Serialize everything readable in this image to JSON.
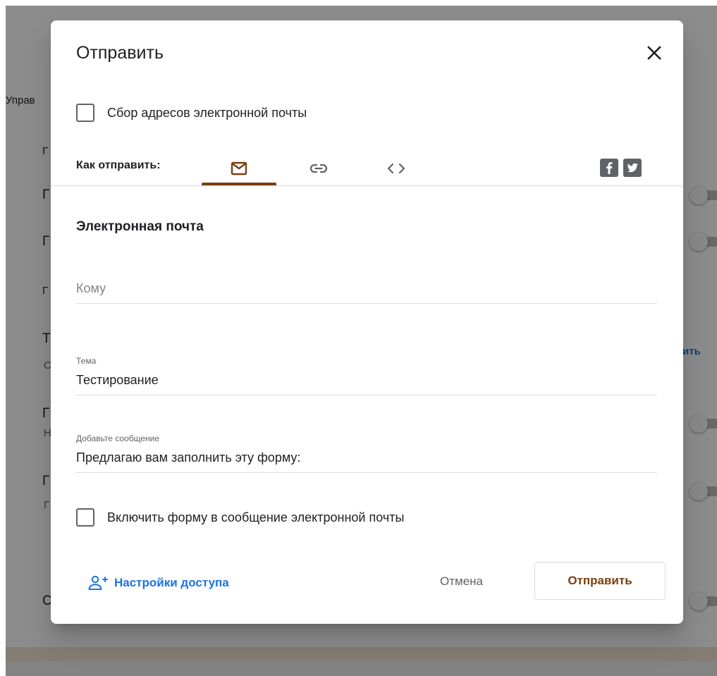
{
  "background": {
    "manage_label": "Управ",
    "row_letters": [
      "Г",
      "Г",
      "Г",
      "Г",
      "Т",
      "Г",
      "Г",
      "С"
    ],
    "row_subs": [
      "С",
      "Н",
      "Г"
    ],
    "link_fragment": "ить"
  },
  "dialog": {
    "title": "Отправить",
    "collect_emails_label": "Сбор адресов электронной почты",
    "send_via_label": "Как отправить:",
    "tabs": {
      "email": "email-icon",
      "link": "link-icon",
      "embed": "embed-code-icon",
      "active": "email"
    },
    "social": {
      "facebook": "facebook-icon",
      "twitter": "twitter-icon"
    },
    "section_title": "Электронная почта",
    "to": {
      "placeholder": "Кому",
      "value": ""
    },
    "subject": {
      "label": "Тема",
      "value": "Тестирование"
    },
    "message": {
      "label": "Добавьте сообщение",
      "value": "Предлагаю вам заполнить эту форму:"
    },
    "include_form_label": "Включить форму в сообщение электронной почты",
    "share_settings_label": "Настройки доступа",
    "cancel_label": "Отмена",
    "send_label": "Отправить"
  },
  "colors": {
    "accent": "#7a3f0c",
    "link_blue": "#1a73e8",
    "scrim": "rgba(0,0,0,0.45)"
  }
}
